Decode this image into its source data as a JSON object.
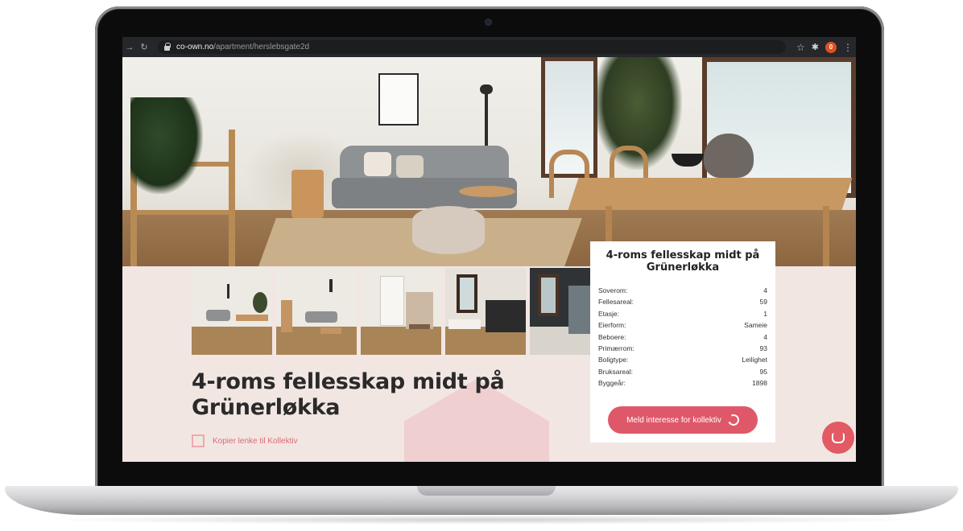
{
  "browser": {
    "url_host": "co-own.no",
    "url_path": "/apartment/herslebsgate2d",
    "notification_count": "0",
    "icons": [
      "arrow-right-icon",
      "reload-icon",
      "lock-icon",
      "star-icon",
      "extension-icon",
      "badge-icon",
      "menu-icon"
    ]
  },
  "listing": {
    "title_line1": "4-roms fellesskap midt på",
    "title_line2": "Grünerløkka",
    "copy_link_label": "Kopier lenke til Kollektiv"
  },
  "gallery": {
    "count": 5,
    "active_index": 0
  },
  "card": {
    "title": "4-roms fellesskap midt på Grünerløkka",
    "specs": [
      {
        "label": "Soverom:",
        "value": "4"
      },
      {
        "label": "Fellesareal:",
        "value": "59"
      },
      {
        "label": "Etasje:",
        "value": "1"
      },
      {
        "label": "Eierform:",
        "value": "Sameie"
      },
      {
        "label": "Beboere:",
        "value": "4"
      },
      {
        "label": "Primærrom:",
        "value": "93"
      },
      {
        "label": "Boligtype:",
        "value": "Leilighet"
      },
      {
        "label": "Bruksareal:",
        "value": "95"
      },
      {
        "label": "Byggeår:",
        "value": "1898"
      }
    ],
    "cta_label": "Meld interesse for kollektiv"
  },
  "colors": {
    "accent": "#df5869",
    "page_bg": "#f2e6e3",
    "house_shape": "#f0cfd0"
  }
}
